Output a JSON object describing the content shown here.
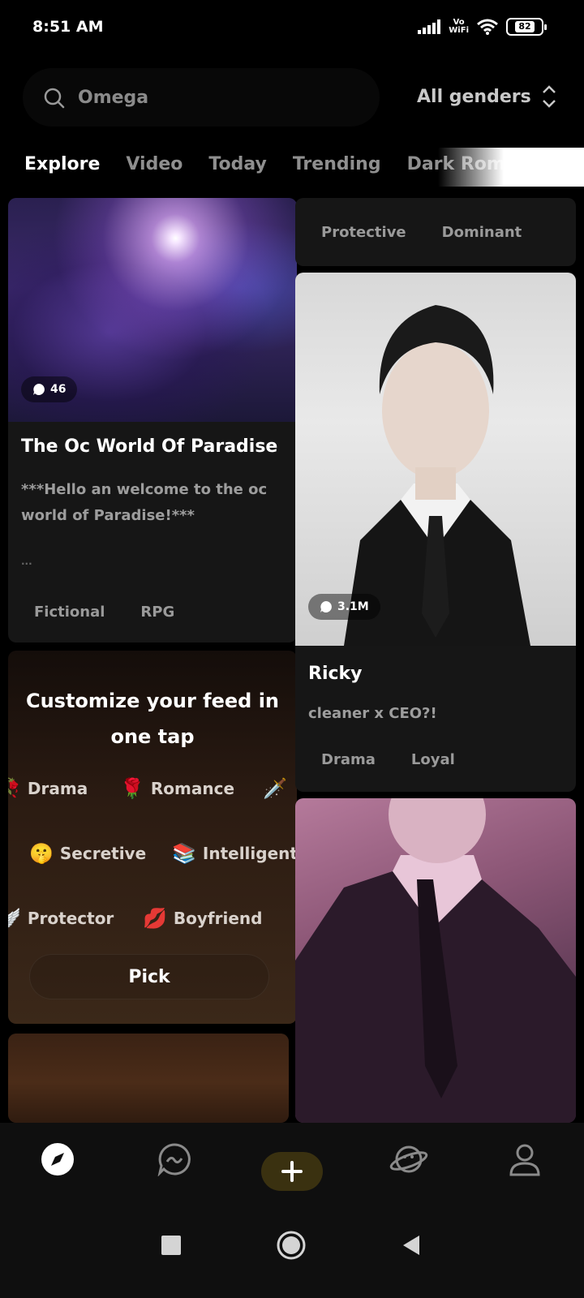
{
  "status_bar": {
    "time": "8:51 AM",
    "network": "Vo\nWiFi",
    "battery": "82"
  },
  "search": {
    "placeholder": "Omega"
  },
  "filter": {
    "label": "All genders"
  },
  "tabs": [
    {
      "label": "Explore",
      "active": true
    },
    {
      "label": "Video"
    },
    {
      "label": "Today"
    },
    {
      "label": "Trending"
    },
    {
      "label": "Dark Romance"
    }
  ],
  "cards": {
    "top_right": {
      "tags": [
        "Protective",
        "Dominant"
      ]
    },
    "paradise": {
      "count": "46",
      "title": "The Oc World Of Paradise",
      "description": "***Hello an welcome to the oc world of Paradise!***",
      "ellipsis": "...",
      "tags": [
        "Fictional",
        "RPG"
      ]
    },
    "ricky": {
      "count": "3.1M",
      "title": "Ricky",
      "description": "cleaner x CEO?!",
      "tags": [
        "Drama",
        "Loyal"
      ]
    }
  },
  "customize": {
    "heading_line1": "Customize your feed in",
    "heading_line2": "one tap",
    "prefs": [
      {
        "label": "Drama",
        "emoji": "🥀"
      },
      {
        "label": "Romance",
        "emoji": "🌹"
      },
      {
        "label": "Secretive",
        "emoji": "🤫"
      },
      {
        "label": "Intelligent",
        "emoji": "📚"
      },
      {
        "label": "Protector",
        "emoji": "🪽"
      },
      {
        "label": "Boyfriend",
        "emoji": "💋"
      }
    ],
    "sword_emoji": "🗡️",
    "pick_label": "Pick"
  },
  "colors": {
    "background": "#000000",
    "card": "#161616",
    "accent": "#3a3110",
    "muted": "#8f8f8f"
  }
}
